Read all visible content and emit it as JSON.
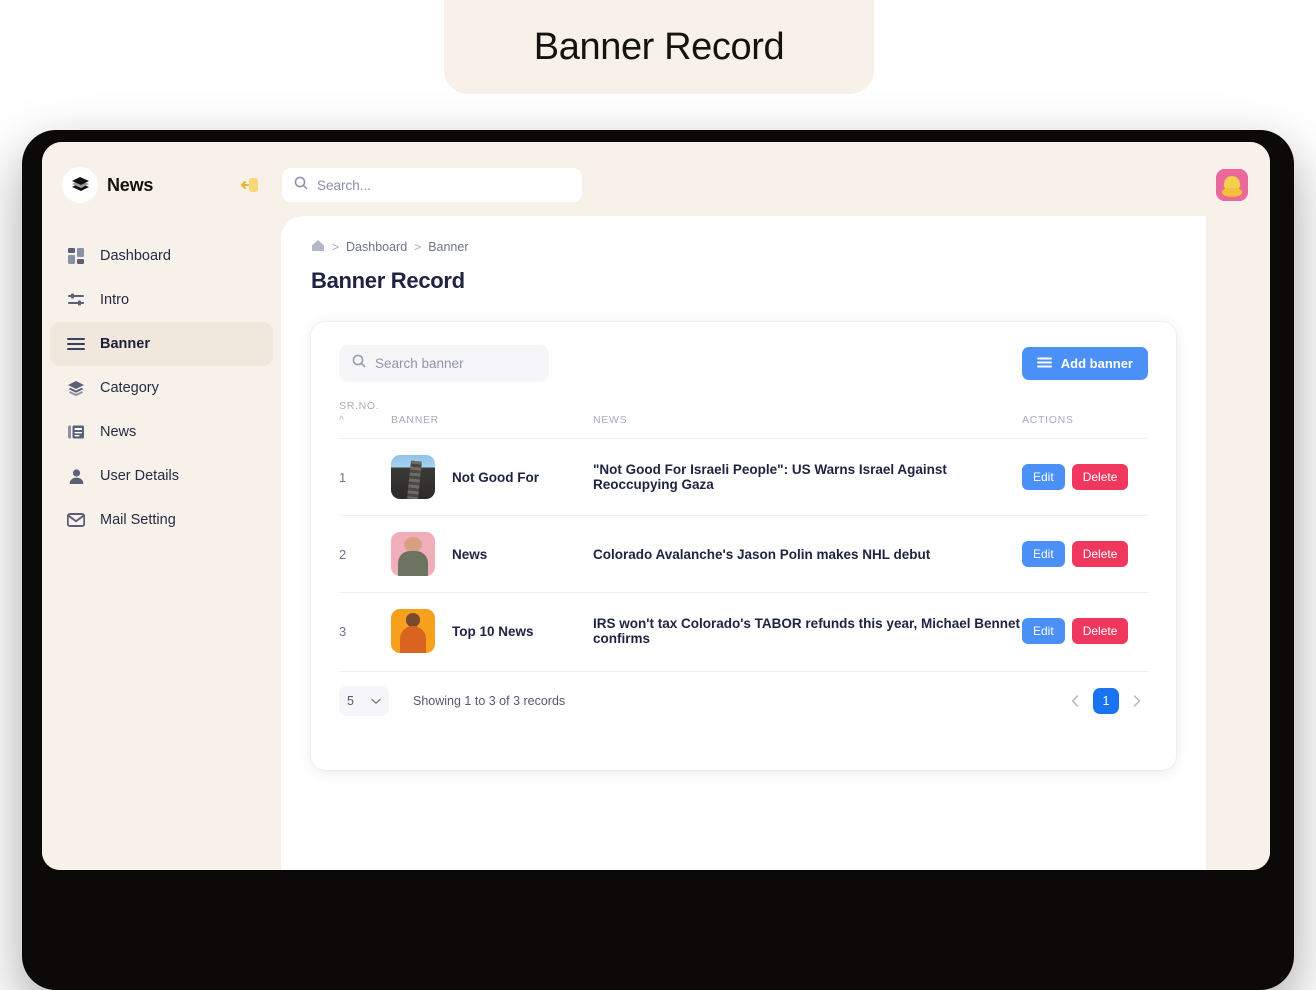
{
  "caption": {
    "title": "Banner Record"
  },
  "sidebar": {
    "brand": "News",
    "brand_logo_icon": "news-stack-icon",
    "collapse_icon": "collapse-sidebar-icon",
    "items": [
      {
        "label": "Dashboard",
        "icon": "dashboard-grid-icon",
        "active": false
      },
      {
        "label": "Intro",
        "icon": "sliders-icon",
        "active": false
      },
      {
        "label": "Banner",
        "icon": "list-lines-icon",
        "active": true
      },
      {
        "label": "Category",
        "icon": "layers-icon",
        "active": false
      },
      {
        "label": "News",
        "icon": "newspaper-icon",
        "active": false
      },
      {
        "label": "User Details",
        "icon": "user-icon",
        "active": false
      },
      {
        "label": "Mail Setting",
        "icon": "envelope-icon",
        "active": false
      }
    ]
  },
  "topbar": {
    "search_placeholder": "Search...",
    "search_value": "",
    "search_icon": "search-icon",
    "avatar_icon": "user-avatar"
  },
  "breadcrumb": {
    "home_icon": "home-icon",
    "separator": ">",
    "items": [
      "Dashboard",
      "Banner"
    ]
  },
  "page": {
    "title": "Banner Record"
  },
  "card": {
    "search_placeholder": "Search banner",
    "search_value": "",
    "search_icon": "search-icon",
    "add_button_label": "Add banner",
    "add_button_icon": "list-lines-icon",
    "add_button_color": "#4a90f7",
    "columns": [
      "SR.NO.",
      "BANNER",
      "NEWS",
      "ACTIONS"
    ],
    "sort_caret_icon": "caret-up-icon",
    "rows": [
      {
        "sr": "1",
        "banner_name": "Not Good For",
        "news": "\"Not Good For Israeli People\": US Warns Israel Against Reoccupying Gaza",
        "thumb": "building-photo",
        "edit_label": "Edit",
        "delete_label": "Delete"
      },
      {
        "sr": "2",
        "banner_name": "News",
        "news": "Colorado Avalanche's Jason Polin makes NHL debut",
        "thumb": "woman-phone-pink-photo",
        "edit_label": "Edit",
        "delete_label": "Delete"
      },
      {
        "sr": "3",
        "banner_name": "Top 10 News",
        "news": "IRS won't tax Colorado's TABOR refunds this year, Michael Bennet confirms",
        "thumb": "woman-orange-photo",
        "edit_label": "Edit",
        "delete_label": "Delete"
      }
    ],
    "footer": {
      "page_size": "5",
      "page_size_caret_icon": "chevron-down-icon",
      "showing_text": "Showing 1 to 3 of 3 records",
      "prev_icon": "chevron-left-icon",
      "next_icon": "chevron-right-icon",
      "current_page": "1"
    }
  },
  "colors": {
    "primary": "#4a90f7",
    "danger": "#f0385e",
    "page_bg": "#f7f1ea",
    "accent_yellow": "#f6cf4e"
  }
}
